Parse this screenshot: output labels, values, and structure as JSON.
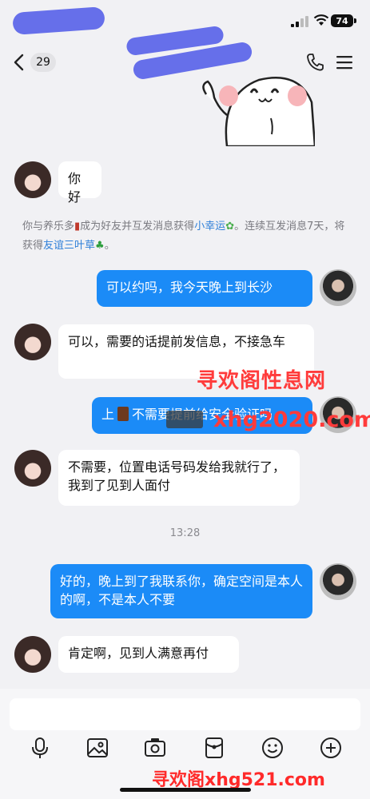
{
  "status_bar": {
    "battery_level": "74"
  },
  "nav": {
    "unread_count": "29",
    "icons": [
      "back-icon",
      "phone-icon",
      "menu-icon"
    ]
  },
  "messages": [
    {
      "side": "received",
      "text": "你好"
    },
    {
      "side": "sent",
      "text": "可以约吗，我今天晚上到长沙"
    },
    {
      "side": "received",
      "text": "可以，需要的话提前发信息，不接急车"
    },
    {
      "side": "sent",
      "text_before": "上",
      "text_after": "不需要提前给安全验证吗"
    },
    {
      "side": "received",
      "text": "不需要，位置电话号码发给我就行了，我到了见到人面付"
    },
    {
      "side": "sent",
      "text": "好的，晚上到了我联系你，确定空间是本人的啊，不是本人不要"
    },
    {
      "side": "received",
      "text": "肯定啊，见到人满意再付"
    }
  ],
  "system_note": {
    "part1": "你与养乐多",
    "part2": "成为好友并互发消息获得",
    "link1": "小幸运",
    "part3": "。连续互发消息7天，将获得",
    "link2": "友谊三叶草",
    "part4": "。"
  },
  "time_divider": "13:28",
  "watermarks": {
    "line1": "寻欢阁性息网",
    "line2": "xhg2020.com",
    "bottom": "寻欢阁xhg521.com"
  },
  "input": {
    "value": "",
    "placeholder": ""
  },
  "toolbar": {
    "icons": [
      "microphone-icon",
      "image-icon",
      "camera-icon",
      "red-packet-icon",
      "emoji-icon",
      "plus-icon"
    ]
  },
  "colors": {
    "sent_bubble": "#1b8bf7",
    "received_bubble": "#ffffff",
    "link": "#2e7fd8",
    "watermark": "#ff3b3b"
  }
}
